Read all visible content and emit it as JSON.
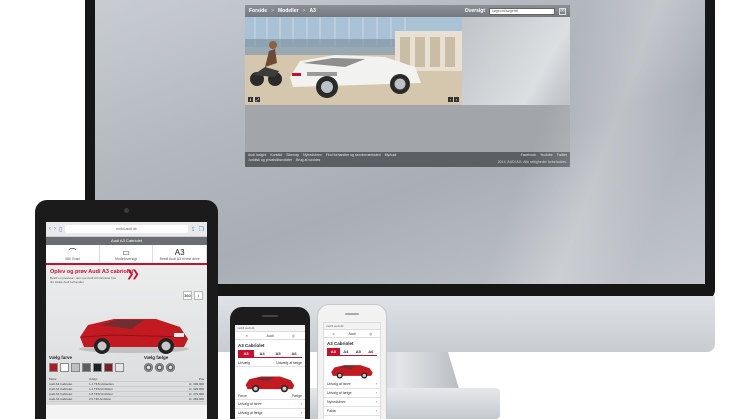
{
  "desktop": {
    "breadcrumb": [
      "Forside",
      "Modeller",
      "A3"
    ],
    "breadcrumb_sep": ">",
    "overview_label": "Oversigt",
    "search_placeholder": "søgeord/søgefelt",
    "footer_links": [
      "Audi Insight",
      "Kontakt",
      "Sitemap",
      "Nyhedsbrev",
      "Find forhandler og serviceværksted",
      "MyAudi"
    ],
    "footer_links2": [
      "Juridisk og privatsiktsnotater",
      "Brug af cookies"
    ],
    "social": [
      "Facebook",
      "Youtube",
      "Twitter"
    ],
    "copyright": "2014. AUDI AG. Alle rettigheder forbeholdes."
  },
  "tablet": {
    "url": "mobil.audi.dk",
    "page_title": "Audi A3 Cabriolet",
    "tabs": [
      {
        "glyph": "⌒",
        "label": "360 Grad"
      },
      {
        "glyph": "▭",
        "label": "Modeloversigt"
      },
      {
        "glyph": "A3",
        "label": "Bestil Audi A3 til test drive"
      }
    ],
    "heading": "Oplev og prøv Audi A3 cabriolet",
    "sub": "Bestil en prøvetur i den nye Audi A3 Cabriolet hos din lokale Audi forhandler.",
    "colors_label": "Vælg farve",
    "rims_label": "Vælg fælge",
    "side_icons": [
      "360",
      "i"
    ],
    "swatches": [
      "#b31b24",
      "#ffffff",
      "#bdbfc2",
      "#5b5e62",
      "#1f2024",
      "#7c1f25",
      "#e6e6e6"
    ],
    "table": [
      [
        "Motor",
        "Udstyr",
        "Pris"
      ],
      [
        "Audi A3 Cabriolet",
        "1.4 TFSI Attraction",
        "kr. 399.900"
      ],
      [
        "Audi A3 Cabriolet",
        "1.4 TFSI Ambition",
        "kr. 429.900"
      ],
      [
        "Audi A3 Cabriolet",
        "1.8 TFSI Ambition",
        "kr. 479.900"
      ],
      [
        "Audi A3 Cabriolet",
        "2.0 TDI Ambition",
        "kr. 469.900"
      ]
    ]
  },
  "phone_black": {
    "url": "mobil.audi.dk",
    "nav": [
      "≡",
      "Audi",
      "◎"
    ],
    "title": "A3 Cabriolet",
    "tabs": [
      "A3",
      "A4",
      "A5",
      "A6"
    ],
    "options": [
      [
        "Udvælg",
        "Udvælg af fælge"
      ],
      [
        "Farve",
        "Fælge"
      ]
    ],
    "list": [
      "Udvalg af farve",
      "Udvalg af fælge"
    ]
  },
  "phone_white": {
    "url": "mobil.audi.dk",
    "nav": [
      "≡",
      "Audi",
      "◎"
    ],
    "title": "A3 Cabriolet",
    "tabs": [
      "A3",
      "A4",
      "A5",
      "A6"
    ],
    "list": [
      "Udvalg af farve",
      "Udvalg af fælge",
      "Nyhedsbrev",
      "Fakta"
    ]
  },
  "colors": {
    "audi_red": "#c8102e",
    "car_red": "#c31a22",
    "car_white": "#f2f2f0"
  }
}
